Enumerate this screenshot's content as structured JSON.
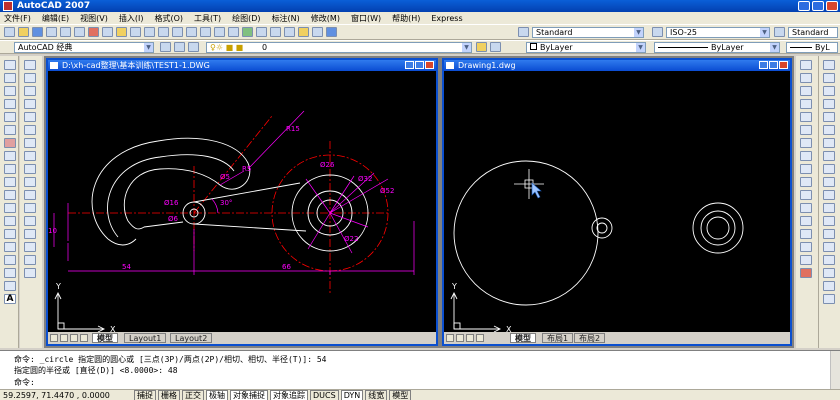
{
  "window": {
    "title": "AutoCAD 2007"
  },
  "menu": [
    "文件(F)",
    "编辑(E)",
    "视图(V)",
    "插入(I)",
    "格式(O)",
    "工具(T)",
    "绘图(D)",
    "标注(N)",
    "修改(M)",
    "窗口(W)",
    "帮助(H)",
    "Express"
  ],
  "toolbar": {
    "text_style": "Standard",
    "dim_style": "ISO-25",
    "table_style": "Standard",
    "workspace": "AutoCAD 经典",
    "layer": "0",
    "color": "ByLayer",
    "linetype": "ByLayer",
    "lineweight": "ByL"
  },
  "drawing_left": {
    "title": "D:\\xh-cad整理\\基本训练\\TEST1-1.DWG",
    "tabs": [
      "模型",
      "Layout1",
      "Layout2"
    ],
    "dims": {
      "d54": "54",
      "d66": "66",
      "r15": "R15",
      "r5": "R5",
      "d55": "Ø5",
      "d26": "Ø26",
      "d32": "Ø32",
      "d52": "Ø52",
      "d22": "Ø22",
      "d16": "Ø16",
      "d6": "Ø6",
      "a30": "30°",
      "ax10": "10"
    },
    "ucs": {
      "x": "X",
      "y": "Y"
    }
  },
  "drawing_right": {
    "title": "Drawing1.dwg",
    "tabs": [
      "模型",
      "布局1",
      "布局2"
    ],
    "ucs": {
      "x": "X",
      "y": "Y"
    }
  },
  "command": {
    "line1": "命令: _circle 指定圆的圆心或 [三点(3P)/两点(2P)/相切、相切、半径(T)]: 54",
    "line2": "指定圆的半径或 [直径(D)] <8.0000>: 48",
    "prompt": "命令:"
  },
  "status": {
    "coords": "59.2597, 71.4470 , 0.0000",
    "buttons": [
      "捕捉",
      "栅格",
      "正交",
      "极轴",
      "对象捕捉",
      "对象追踪",
      "DUCS",
      "DYN",
      "线宽",
      "模型"
    ]
  },
  "colors": {
    "titlebar": "#0a4cd2",
    "canvas": "#000000",
    "red_centerline": "#ff0000",
    "magenta_dim": "#ff00ff",
    "geometry": "#ffffff"
  }
}
